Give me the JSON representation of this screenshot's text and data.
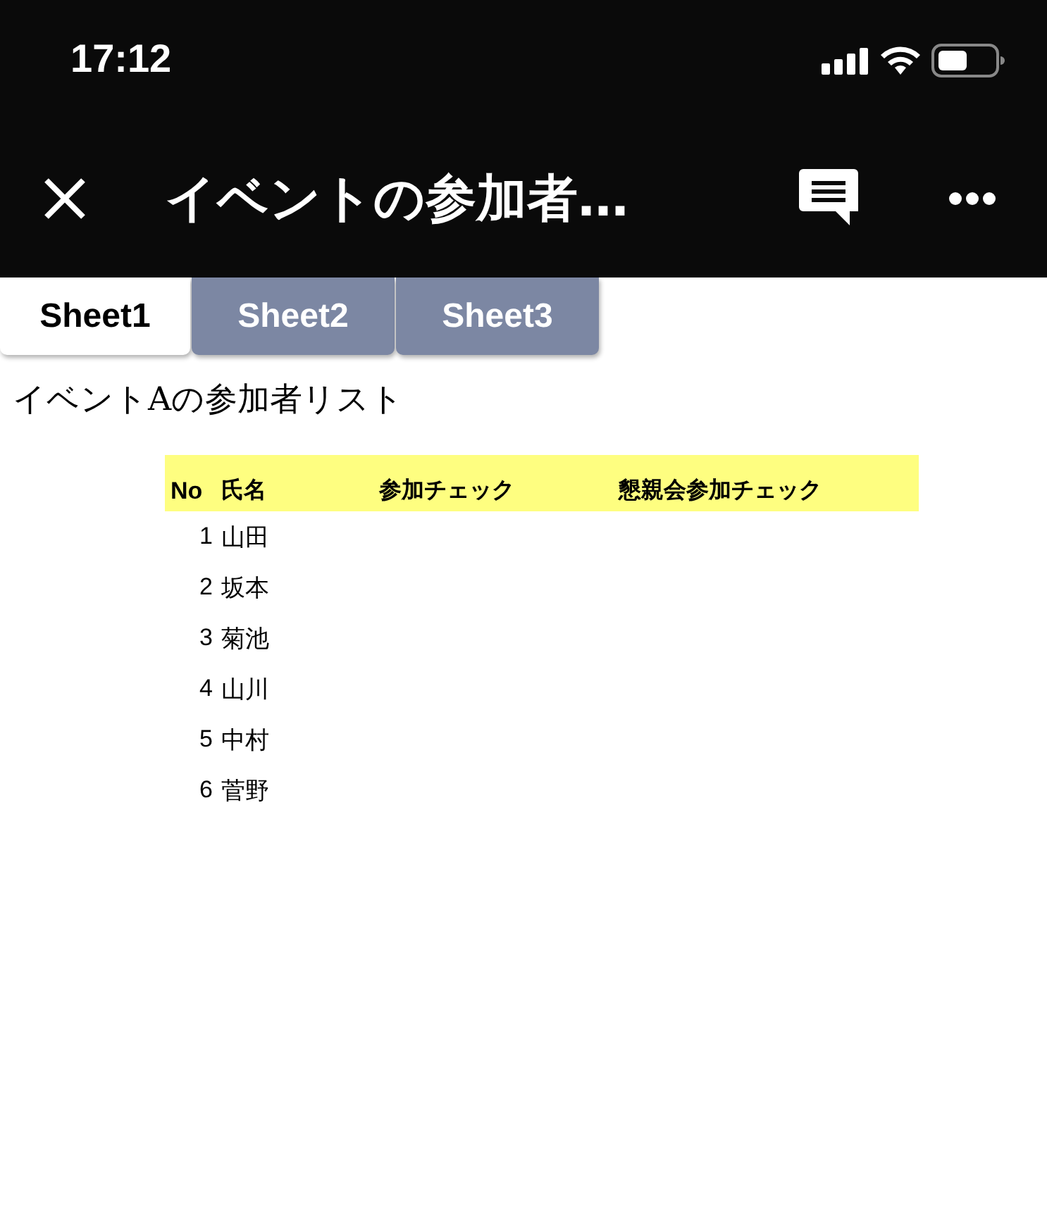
{
  "status_bar": {
    "time": "17:12"
  },
  "nav_bar": {
    "title": "イベントの参加者…"
  },
  "tabs": [
    {
      "label": "Sheet1",
      "selected": true
    },
    {
      "label": "Sheet2",
      "selected": false
    },
    {
      "label": "Sheet3",
      "selected": false
    }
  ],
  "sheet_title": "イベントAの参加者リスト",
  "table": {
    "columns": [
      "No",
      "氏名",
      "参加チェック",
      "懇親会参加チェック"
    ],
    "rows": [
      [
        "1",
        "山田"
      ],
      [
        "2",
        "坂本"
      ],
      [
        "3",
        "菊池"
      ],
      [
        "4",
        "山川"
      ],
      [
        "5",
        "中村"
      ],
      [
        "6",
        "菅野"
      ]
    ]
  }
}
